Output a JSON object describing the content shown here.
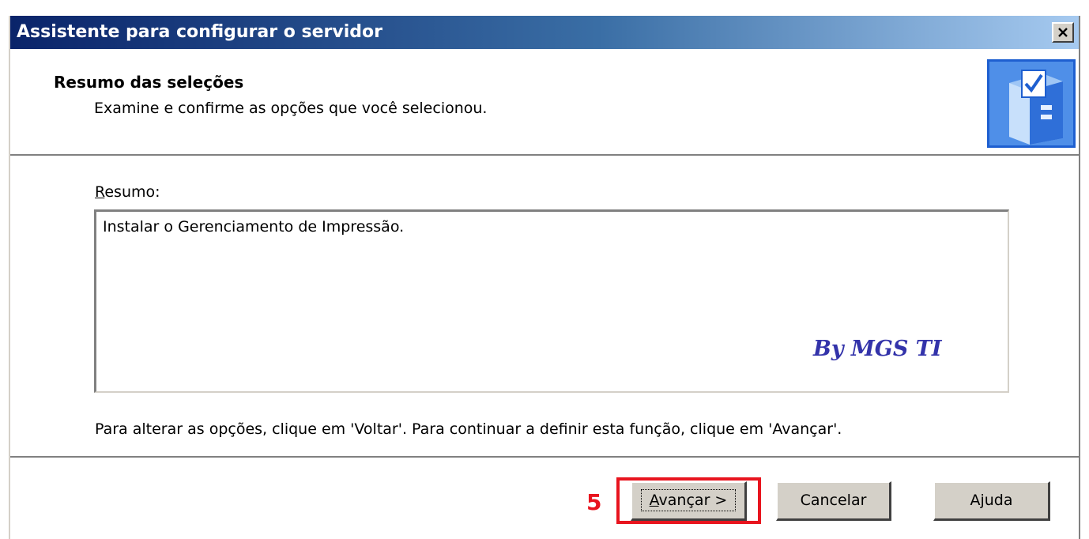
{
  "window": {
    "title": "Assistente para configurar o servidor",
    "close_label": "×"
  },
  "header": {
    "title": "Resumo das seleções",
    "subtitle": "Examine e confirme as opções que você selecionou.",
    "icon": "server-checklist-icon"
  },
  "body": {
    "summary_label_accel": "R",
    "summary_label_rest": "esumo:",
    "summary_text": "Instalar o Gerenciamento de Impressão.",
    "watermark": "By MGS TI",
    "instruction": "Para alterar as opções, clique em 'Voltar'. Para continuar a definir esta função, clique em 'Avançar'."
  },
  "buttons": {
    "next_accel": "A",
    "next_rest": "vançar >",
    "cancel": "Cancelar",
    "help": "Ajuda"
  },
  "annotation": {
    "step_number": "5",
    "color": "#e8141e"
  }
}
